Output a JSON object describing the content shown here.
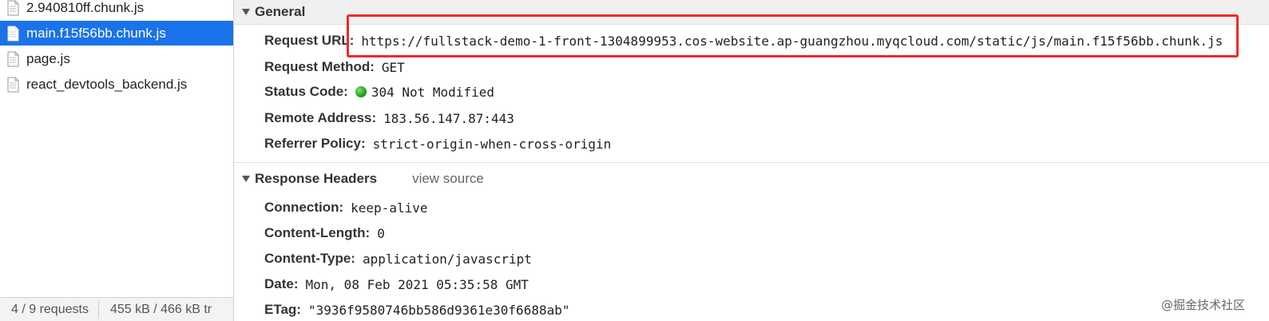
{
  "files": [
    {
      "name": "2.940810ff.chunk.js",
      "selected": false
    },
    {
      "name": "main.f15f56bb.chunk.js",
      "selected": true
    },
    {
      "name": "page.js",
      "selected": false
    },
    {
      "name": "react_devtools_backend.js",
      "selected": false
    }
  ],
  "status_bar": {
    "requests": "4 / 9 requests",
    "transferred": "455 kB / 466 kB tr"
  },
  "general": {
    "title": "General",
    "rows": [
      {
        "key": "Request URL:",
        "value": "https://fullstack-demo-1-front-1304899953.cos-website.ap-guangzhou.myqcloud.com/static/js/main.f15f56bb.chunk.js"
      },
      {
        "key": "Request Method:",
        "value": "GET"
      },
      {
        "key": "Status Code:",
        "value": "304 Not Modified"
      },
      {
        "key": "Remote Address:",
        "value": "183.56.147.87:443"
      },
      {
        "key": "Referrer Policy:",
        "value": "strict-origin-when-cross-origin"
      }
    ]
  },
  "response_headers": {
    "title": "Response Headers",
    "view_source": "view source",
    "rows": [
      {
        "key": "Connection:",
        "value": "keep-alive"
      },
      {
        "key": "Content-Length:",
        "value": "0"
      },
      {
        "key": "Content-Type:",
        "value": "application/javascript"
      },
      {
        "key": "Date:",
        "value": "Mon, 08 Feb 2021 05:35:58 GMT"
      },
      {
        "key": "ETag:",
        "value": "\"3936f9580746bb586d9361e30f6688ab\""
      }
    ]
  },
  "watermark": "@掘金技术社区",
  "colors": {
    "selected_bg": "#1a73e8",
    "highlight_border": "#ee2a2a",
    "status_ok": "#21a121"
  }
}
